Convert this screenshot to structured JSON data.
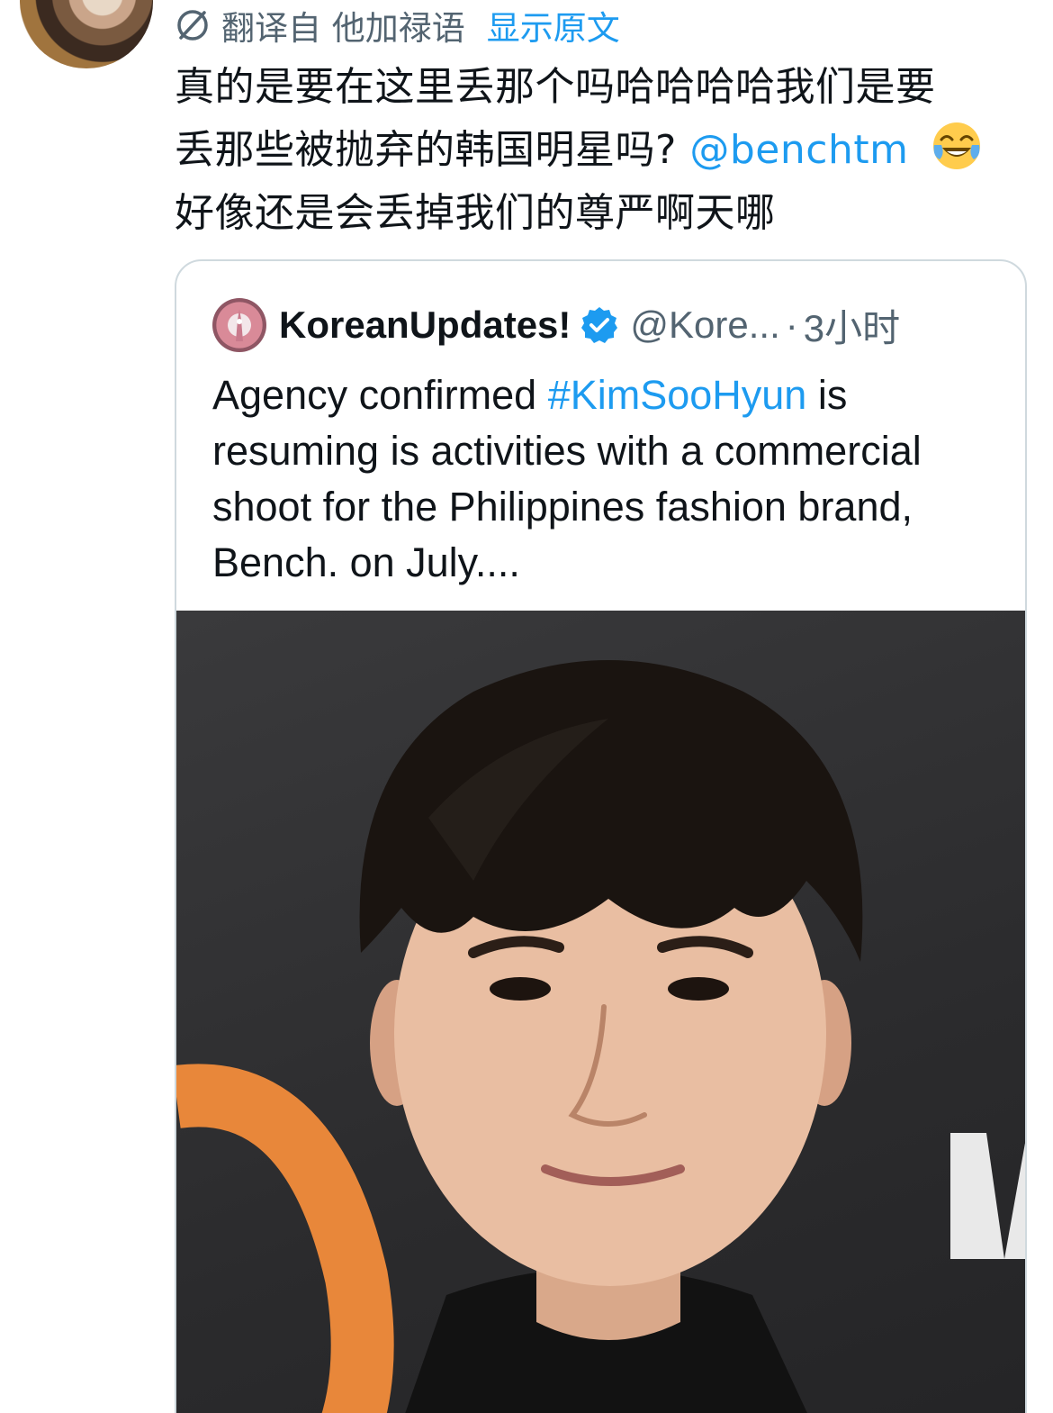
{
  "translation": {
    "label": "翻译自 他加禄语",
    "show_original": "显示原文"
  },
  "tweet": {
    "line1": "真的是要在这里丢那个吗哈哈哈哈我们是要",
    "line2_text": "丢那些被抛弃的韩国明星吗?",
    "mention": "@benchtm",
    "line3": "好像还是会丢掉我们的尊严啊天哪",
    "emoji": "face-with-tears-of-joy"
  },
  "quote": {
    "name": "KoreanUpdates!",
    "handle": "@Kore...",
    "separator": "·",
    "time": "3小时",
    "text_before": "Agency confirmed ",
    "hashtag": "#KimSooHyun",
    "text_after": " is resuming is activities with a commercial shoot for the Philippines fashion brand, Bench. on July....",
    "image_alt": "photo"
  },
  "colors": {
    "link": "#1d9bf0",
    "secondary": "#536471",
    "border": "#cfd9de"
  }
}
